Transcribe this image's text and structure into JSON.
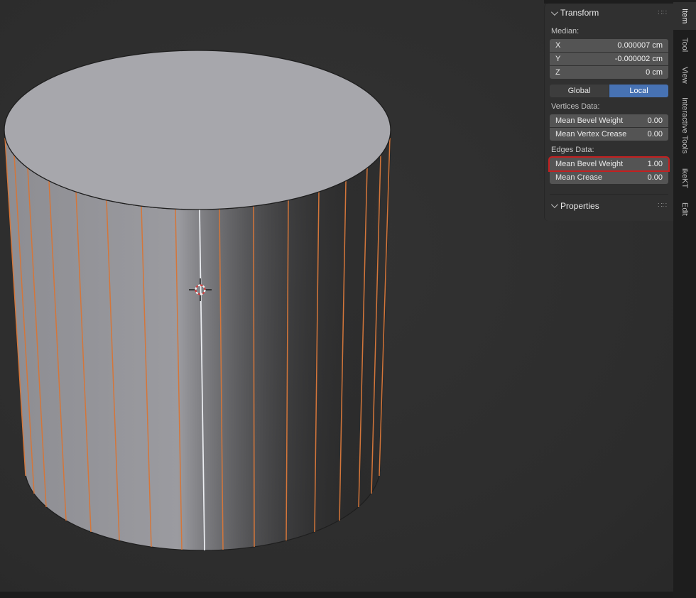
{
  "panel": {
    "transform": {
      "title": "Transform"
    },
    "median_label": "Median:",
    "median_rows": [
      {
        "axis": "X",
        "value": "0.000007 cm"
      },
      {
        "axis": "Y",
        "value": "-0.000002 cm"
      },
      {
        "axis": "Z",
        "value": "0 cm"
      }
    ],
    "orientation": {
      "global": "Global",
      "local": "Local",
      "active": "Local"
    },
    "vertices_label": "Vertices Data:",
    "vertices_rows": [
      {
        "label": "Mean Bevel Weight",
        "value": "0.00"
      },
      {
        "label": "Mean Vertex Crease",
        "value": "0.00"
      }
    ],
    "edges_label": "Edges Data:",
    "edges_rows": [
      {
        "label": "Mean Bevel Weight",
        "value": "1.00",
        "highlighted": true
      },
      {
        "label": "Mean Crease",
        "value": "0.00"
      }
    ],
    "properties": {
      "title": "Properties"
    },
    "grip_icon": "∷∷"
  },
  "tabs": [
    {
      "label": "Item",
      "active": true
    },
    {
      "label": "Tool",
      "active": false
    },
    {
      "label": "View",
      "active": false
    },
    {
      "label": "Interactive Tools",
      "active": false
    },
    {
      "label": "ikeKT",
      "active": false
    },
    {
      "label": "Edit",
      "active": false
    }
  ],
  "colors": {
    "accent_blue": "#4772b3",
    "highlight_red": "#c32020",
    "selected_edge_orange": "#d4763a",
    "active_edge_white": "#edeff3",
    "panel_bg": "#303030",
    "field_bg": "#545454",
    "viewport_bg": "#2e2e2e"
  }
}
